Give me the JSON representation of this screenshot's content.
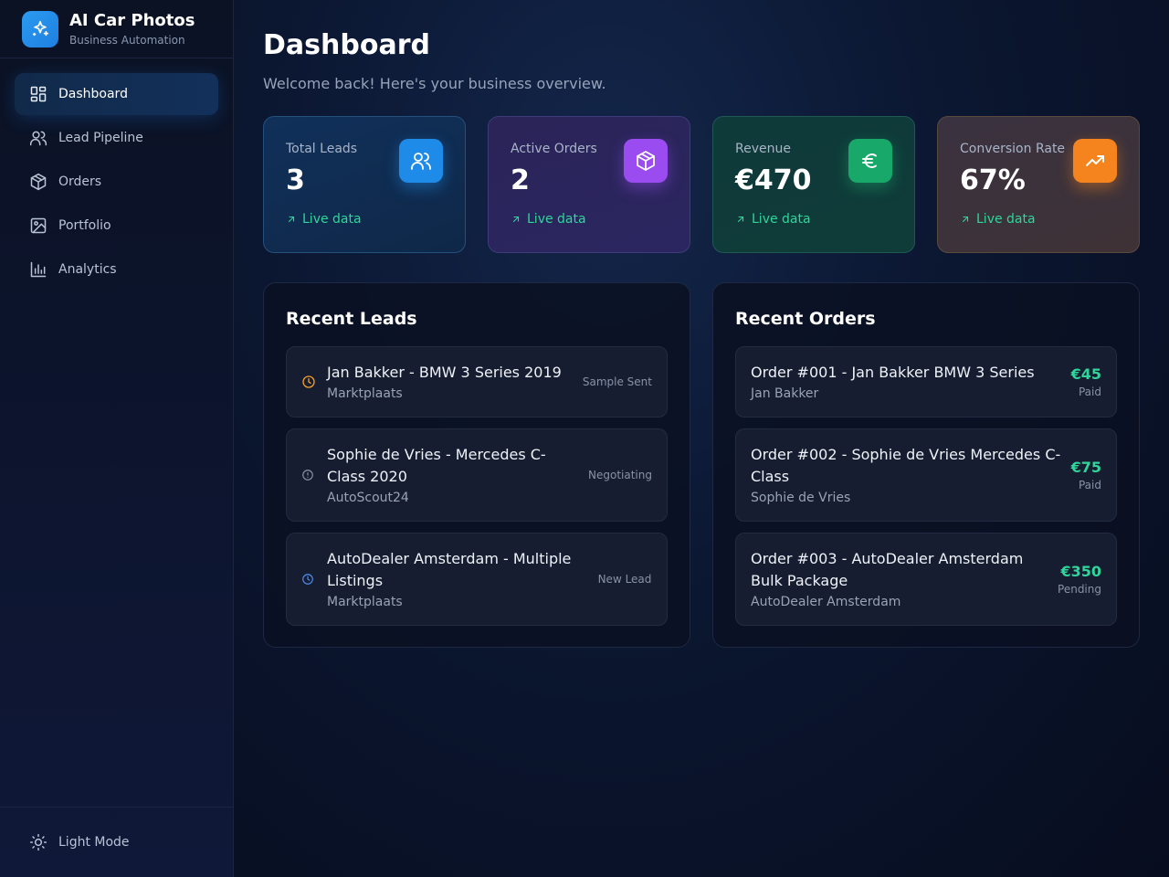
{
  "brand": {
    "title": "AI Car Photos",
    "subtitle": "Business Automation"
  },
  "nav": {
    "items": [
      {
        "label": "Dashboard",
        "icon": "grid-icon",
        "active": true
      },
      {
        "label": "Lead Pipeline",
        "icon": "users-icon"
      },
      {
        "label": "Orders",
        "icon": "package-icon"
      },
      {
        "label": "Portfolio",
        "icon": "image-icon"
      },
      {
        "label": "Analytics",
        "icon": "bar-chart-icon"
      }
    ],
    "footer_label": "Light Mode"
  },
  "header": {
    "title": "Dashboard",
    "subtitle": "Welcome back! Here's your business overview."
  },
  "stats": [
    {
      "label": "Total Leads",
      "value": "3",
      "trend": "Live data",
      "icon": "users-icon",
      "color": "#1f8be8"
    },
    {
      "label": "Active Orders",
      "value": "2",
      "trend": "Live data",
      "icon": "package-icon",
      "color": "#9a4cf0"
    },
    {
      "label": "Revenue",
      "value": "€470",
      "trend": "Live data",
      "icon": "euro-icon",
      "color": "#18a86a"
    },
    {
      "label": "Conversion Rate",
      "value": "67%",
      "trend": "Live data",
      "icon": "trending-up-icon",
      "color": "#f5831e"
    }
  ],
  "recent_leads": {
    "title": "Recent Leads",
    "items": [
      {
        "title": "Jan Bakker - BMW 3 Series 2019",
        "source": "Marktplaats",
        "status": "Sample Sent",
        "icon": "clock-icon",
        "icon_color": "#f59e2a"
      },
      {
        "title": "Sophie de Vries - Mercedes C-Class 2020",
        "source": "AutoScout24",
        "status": "Negotiating",
        "icon": "alert-circle-icon",
        "icon_color": "#8a94a8"
      },
      {
        "title": "AutoDealer Amsterdam - Multiple Listings",
        "source": "Marktplaats",
        "status": "New Lead",
        "icon": "clock-icon",
        "icon_color": "#4f8ff0"
      }
    ]
  },
  "recent_orders": {
    "title": "Recent Orders",
    "items": [
      {
        "title": "Order #001 - Jan Bakker BMW 3 Series",
        "customer": "Jan Bakker",
        "amount": "€45",
        "state": "Paid"
      },
      {
        "title": "Order #002 - Sophie de Vries Mercedes C-Class",
        "customer": "Sophie de Vries",
        "amount": "€75",
        "state": "Paid"
      },
      {
        "title": "Order #003 - AutoDealer Amsterdam Bulk Package",
        "customer": "AutoDealer Amsterdam",
        "amount": "€350",
        "state": "Pending"
      }
    ]
  }
}
